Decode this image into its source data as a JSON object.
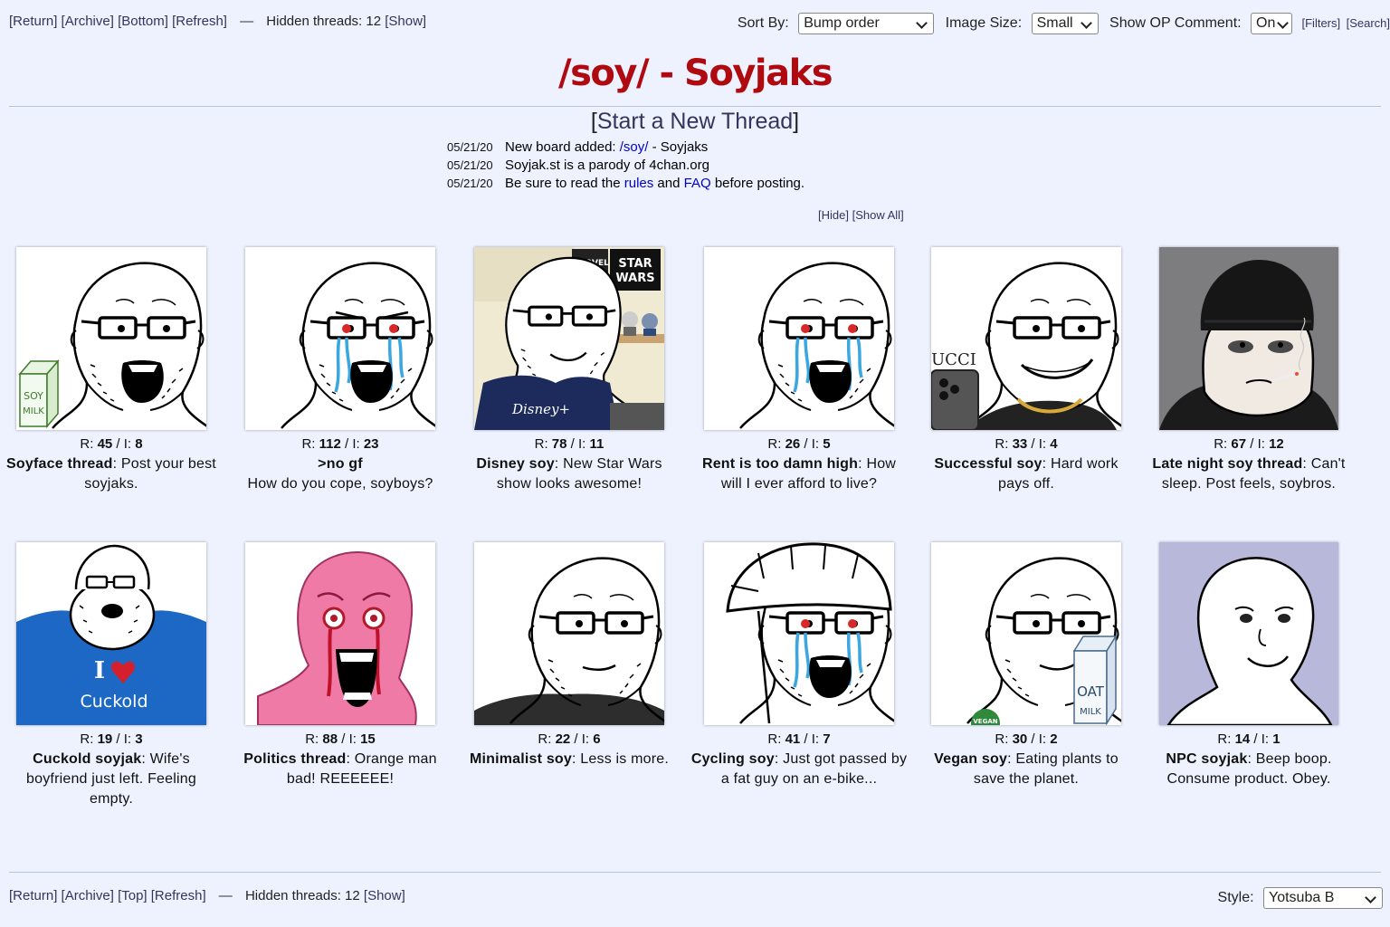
{
  "nav_top": {
    "links": [
      "[Return]",
      "[Archive]",
      "[Bottom]",
      "[Refresh]"
    ],
    "hidden_label": "Hidden threads: 12",
    "show": "[Show]",
    "sort_label": "Sort By:",
    "sort_value": "Bump order",
    "size_label": "Image Size:",
    "size_value": "Small",
    "op_label": "Show OP Comment:",
    "op_value": "On",
    "filters": "[Filters]",
    "search": "[Search]"
  },
  "board": {
    "title": "/soy/ - Soyjaks",
    "start_thread": "Start a New Thread"
  },
  "news": [
    {
      "date": "05/21/20",
      "pre": "New board added: ",
      "link": "/soy/",
      "post": " - Soyjaks"
    },
    {
      "date": "05/21/20",
      "pre": "Soyjak.st is a parody of 4chan.org",
      "link": "",
      "post": ""
    },
    {
      "date": "05/21/20",
      "pre": "Be sure to read the ",
      "link": "rules",
      "mid": " and ",
      "link2": "FAQ",
      "post": " before posting."
    }
  ],
  "hide_links": {
    "hide": "[Hide]",
    "show_all": "[Show All]"
  },
  "threads": [
    {
      "r": "45",
      "i": "8",
      "subject": "Soyface thread",
      "comment": "Post your best soyjaks.",
      "icon": "soy-milk-soyjak-icon"
    },
    {
      "r": "112",
      "i": "23",
      "subject": ">no gf",
      "comment": "How do you cope, soyboys?",
      "icon": "crying-soyjak-icon"
    },
    {
      "r": "78",
      "i": "11",
      "subject": "Disney soy",
      "comment": "New Star Wars show looks awesome!",
      "icon": "disney-soyjak-icon"
    },
    {
      "r": "26",
      "i": "5",
      "subject": "Rent is too damn high",
      "comment": "How will I ever afford to live?",
      "icon": "crying-soyjak-icon"
    },
    {
      "r": "33",
      "i": "4",
      "subject": "Successful soy",
      "comment": "Hard work pays off.",
      "icon": "smug-soyjak-icon"
    },
    {
      "r": "67",
      "i": "12",
      "subject": "Late night soy thread",
      "comment": "Can't sleep. Post feels, soybros.",
      "icon": "beanie-doomer-icon"
    },
    {
      "r": "19",
      "i": "3",
      "subject": "Cuckold soyjak",
      "comment": "Wife's boyfriend just left. Feeling empty.",
      "icon": "cuckold-soyjak-icon"
    },
    {
      "r": "88",
      "i": "15",
      "subject": "Politics thread",
      "comment": "Orange man bad! REEEEEE!",
      "icon": "pink-screaming-soyjak-icon"
    },
    {
      "r": "22",
      "i": "6",
      "subject": "Minimalist soy",
      "comment": "Less is more.",
      "icon": "minimalist-soyjak-icon"
    },
    {
      "r": "41",
      "i": "7",
      "subject": "Cycling soy",
      "comment": "Just got passed by a fat guy on an e-bike...",
      "icon": "helmet-soyjak-icon"
    },
    {
      "r": "30",
      "i": "2",
      "subject": "Vegan soy",
      "comment": "Eating plants to save the planet.",
      "icon": "oat-milk-soyjak-icon"
    },
    {
      "r": "14",
      "i": "1",
      "subject": "NPC soyjak",
      "comment": "Beep boop. Consume product. Obey.",
      "icon": "npc-soyjak-icon"
    }
  ],
  "thumb_text": {
    "soy": "SOY",
    "milk": "MILK",
    "marvel": "MARVEL",
    "star": "STAR",
    "wars": "WARS",
    "disney": "Disney+",
    "gucci": "UCCI",
    "i": "I",
    "cuckold": "Cuckold",
    "vegan": "VEGAN",
    "oat": "OAT",
    "oatmilk": "MILK"
  },
  "nav_bottom": {
    "links": [
      "[Return]",
      "[Archive]",
      "[Top]",
      "[Refresh]"
    ],
    "hidden_label": "Hidden threads: 12",
    "show": "[Show]",
    "style_label": "Style:",
    "style_value": "Yotsuba B"
  },
  "colors": {
    "title": "#af0a0f",
    "link": "#34345c",
    "background": "#eef2ff"
  }
}
